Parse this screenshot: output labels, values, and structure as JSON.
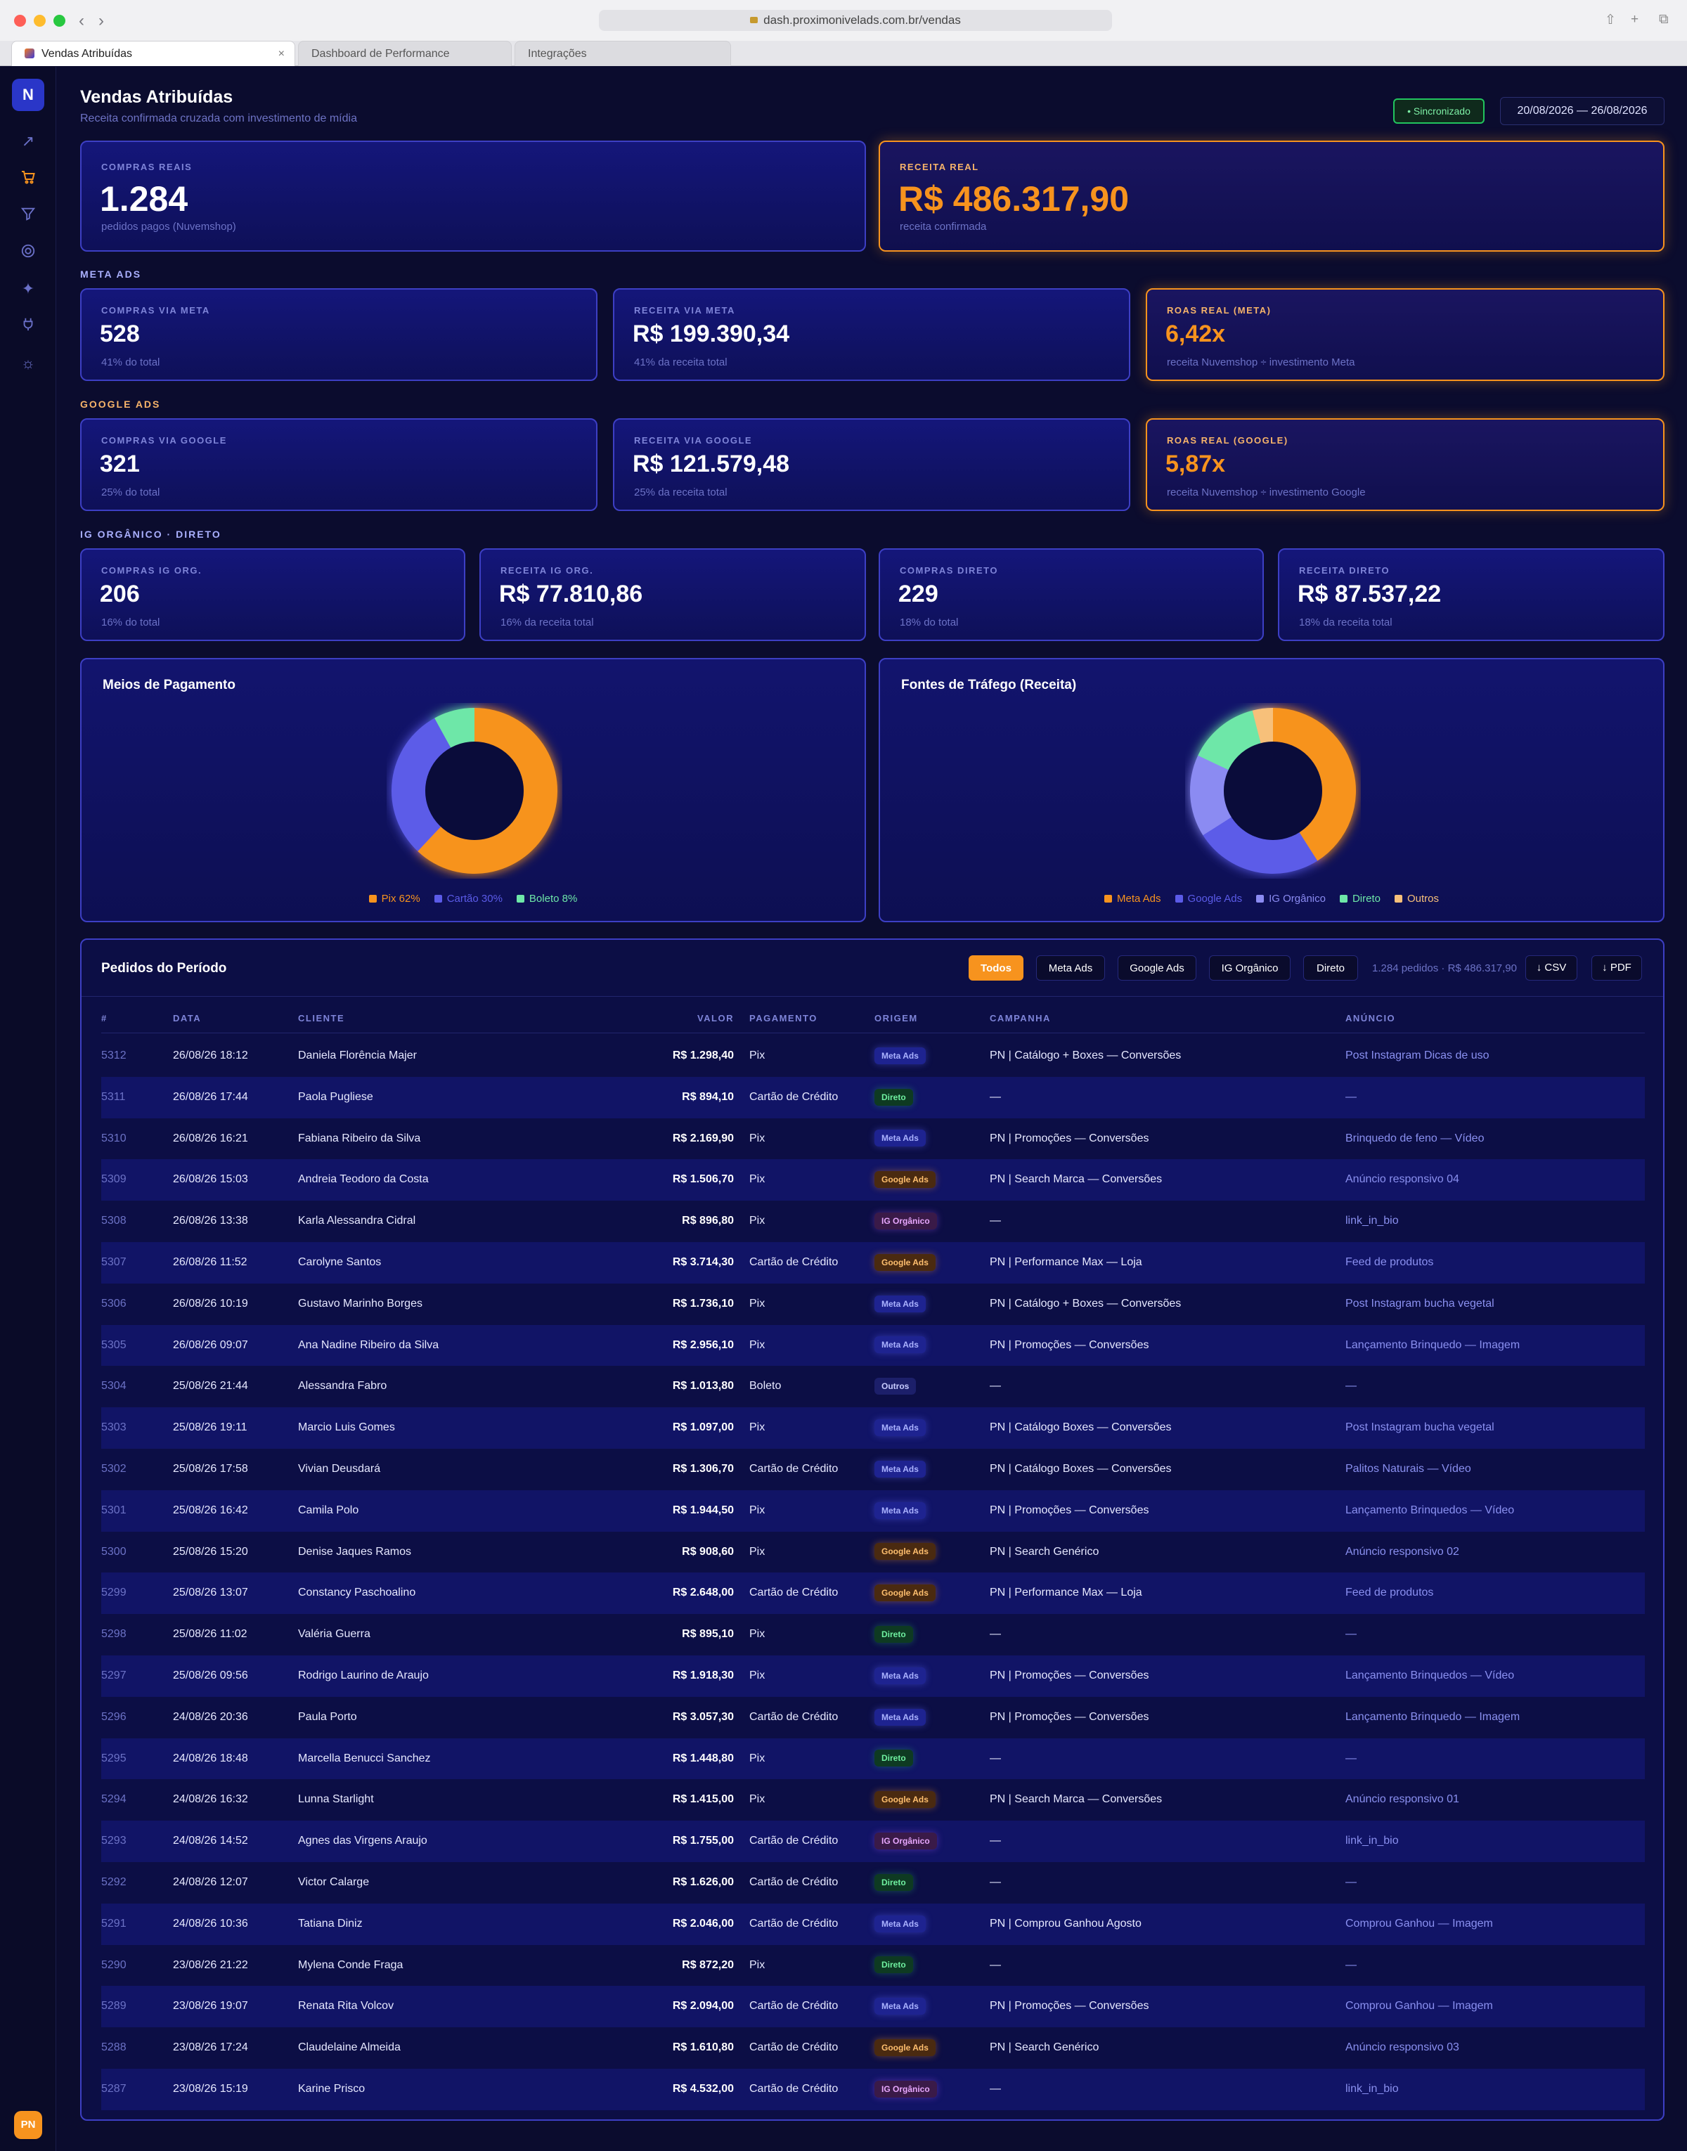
{
  "browser": {
    "url": "dash.proximonivelads.com.br/vendas",
    "tabs": [
      "Vendas Atribuídas",
      "Dashboard de Performance",
      "Integrações"
    ]
  },
  "sidebar": {
    "logo": "N",
    "avatar": "PN",
    "icons": [
      "trend-icon",
      "cart-icon",
      "filter-icon",
      "target-icon",
      "sparkle-icon",
      "plug-icon",
      "gear-icon"
    ]
  },
  "header": {
    "title": "Vendas Atribuídas",
    "subtitle": "Receita confirmada cruzada com investimento de mídia",
    "sync_label": "• Sincronizado",
    "date_range": "20/08/2026 — 26/08/2026"
  },
  "summary": {
    "purchases": {
      "label": "COMPRAS REAIS",
      "value": "1.284",
      "sub": "pedidos pagos (Nuvemshop)"
    },
    "revenue": {
      "label": "RECEITA REAL",
      "value": "R$ 486.317,90",
      "sub": "receita confirmada"
    }
  },
  "meta": {
    "section": "META ADS",
    "purchases": {
      "label": "COMPRAS VIA META",
      "value": "528",
      "sub": "41% do total"
    },
    "revenue": {
      "label": "RECEITA VIA META",
      "value": "R$ 199.390,34",
      "sub": "41% da receita total"
    },
    "roas": {
      "label": "ROAS REAL (META)",
      "value": "6,42x",
      "sub": "receita Nuvemshop ÷ investimento Meta"
    }
  },
  "google": {
    "section": "GOOGLE ADS",
    "purchases": {
      "label": "COMPRAS VIA GOOGLE",
      "value": "321",
      "sub": "25% do total"
    },
    "revenue": {
      "label": "RECEITA VIA GOOGLE",
      "value": "R$ 121.579,48",
      "sub": "25% da receita total"
    },
    "roas": {
      "label": "ROAS REAL (GOOGLE)",
      "value": "5,87x",
      "sub": "receita Nuvemshop ÷ investimento Google"
    }
  },
  "organic": {
    "section": "IG ORGÂNICO · DIRETO",
    "ig_purchases": {
      "label": "COMPRAS IG ORG.",
      "value": "206",
      "sub": "16% do total"
    },
    "ig_revenue": {
      "label": "RECEITA IG ORG.",
      "value": "R$ 77.810,86",
      "sub": "16% da receita total"
    },
    "direct_purchases": {
      "label": "COMPRAS DIRETO",
      "value": "229",
      "sub": "18% do total"
    },
    "direct_revenue": {
      "label": "RECEITA DIRETO",
      "value": "R$ 87.537,22",
      "sub": "18% da receita total"
    }
  },
  "chart_data": [
    {
      "type": "pie",
      "title": "Meios de Pagamento",
      "categories": [
        "Pix 62%",
        "Cartão 30%",
        "Boleto 8%"
      ],
      "values": [
        62,
        30,
        8
      ],
      "colors": [
        "#f7931e",
        "#5b5be8",
        "#6ee7a8"
      ],
      "legend": "bottom"
    },
    {
      "type": "pie",
      "title": "Fontes de Tráfego (Receita)",
      "categories": [
        "Meta Ads",
        "Google Ads",
        "IG Orgânico",
        "Direto",
        "Outros"
      ],
      "values": [
        41,
        25,
        16,
        14,
        4
      ],
      "colors": [
        "#f7931e",
        "#5b5be8",
        "#8b8bf2",
        "#6ee7a8",
        "#f7c07a"
      ],
      "legend": "bottom"
    }
  ],
  "orders": {
    "title": "Pedidos do Período",
    "filters": [
      "Todos",
      "Meta Ads",
      "Google Ads",
      "IG Orgânico",
      "Direto"
    ],
    "summary": "1.284 pedidos · R$ 486.317,90",
    "csv_label": "↓ CSV",
    "pdf_label": "↓ PDF",
    "columns": [
      "#",
      "DATA",
      "CLIENTE",
      "VALOR",
      "PAGAMENTO",
      "ORIGEM",
      "CAMPANHA",
      "ANÚNCIO"
    ],
    "rows": [
      {
        "id": "5312",
        "date": "26/08/26 18:12",
        "client": "Daniela Florência Majer",
        "value": "R$ 1.298,40",
        "payment": "Pix",
        "origin": "Meta Ads",
        "campaign": "PN | Catálogo + Boxes — Conversões",
        "ad": "Post Instagram Dicas de uso"
      },
      {
        "id": "5311",
        "date": "26/08/26 17:44",
        "client": "Paola Pugliese",
        "value": "R$ 894,10",
        "payment": "Cartão de Crédito",
        "origin": "Direto",
        "campaign": "—",
        "ad": "—"
      },
      {
        "id": "5310",
        "date": "26/08/26 16:21",
        "client": "Fabiana Ribeiro da Silva",
        "value": "R$ 2.169,90",
        "payment": "Pix",
        "origin": "Meta Ads",
        "campaign": "PN | Promoções — Conversões",
        "ad": "Brinquedo de feno — Vídeo"
      },
      {
        "id": "5309",
        "date": "26/08/26 15:03",
        "client": "Andreia Teodoro da Costa",
        "value": "R$ 1.506,70",
        "payment": "Pix",
        "origin": "Google Ads",
        "campaign": "PN | Search Marca — Conversões",
        "ad": "Anúncio responsivo 04"
      },
      {
        "id": "5308",
        "date": "26/08/26 13:38",
        "client": "Karla Alessandra Cidral",
        "value": "R$ 896,80",
        "payment": "Pix",
        "origin": "IG Orgânico",
        "campaign": "—",
        "ad": "link_in_bio"
      },
      {
        "id": "5307",
        "date": "26/08/26 11:52",
        "client": "Carolyne Santos",
        "value": "R$ 3.714,30",
        "payment": "Cartão de Crédito",
        "origin": "Google Ads",
        "campaign": "PN | Performance Max — Loja",
        "ad": "Feed de produtos"
      },
      {
        "id": "5306",
        "date": "26/08/26 10:19",
        "client": "Gustavo Marinho Borges",
        "value": "R$ 1.736,10",
        "payment": "Pix",
        "origin": "Meta Ads",
        "campaign": "PN | Catálogo + Boxes — Conversões",
        "ad": "Post Instagram bucha vegetal"
      },
      {
        "id": "5305",
        "date": "26/08/26 09:07",
        "client": "Ana Nadine Ribeiro da Silva",
        "value": "R$ 2.956,10",
        "payment": "Pix",
        "origin": "Meta Ads",
        "campaign": "PN | Promoções — Conversões",
        "ad": "Lançamento Brinquedo — Imagem"
      },
      {
        "id": "5304",
        "date": "25/08/26 21:44",
        "client": "Alessandra Fabro",
        "value": "R$ 1.013,80",
        "payment": "Boleto",
        "origin": "Outros",
        "campaign": "—",
        "ad": "—"
      },
      {
        "id": "5303",
        "date": "25/08/26 19:11",
        "client": "Marcio Luis Gomes",
        "value": "R$ 1.097,00",
        "payment": "Pix",
        "origin": "Meta Ads",
        "campaign": "PN | Catálogo Boxes — Conversões",
        "ad": "Post Instagram bucha vegetal"
      },
      {
        "id": "5302",
        "date": "25/08/26 17:58",
        "client": "Vivian Deusdará",
        "value": "R$ 1.306,70",
        "payment": "Cartão de Crédito",
        "origin": "Meta Ads",
        "campaign": "PN | Catálogo Boxes — Conversões",
        "ad": "Palitos Naturais — Vídeo"
      },
      {
        "id": "5301",
        "date": "25/08/26 16:42",
        "client": "Camila Polo",
        "value": "R$ 1.944,50",
        "payment": "Pix",
        "origin": "Meta Ads",
        "campaign": "PN | Promoções — Conversões",
        "ad": "Lançamento Brinquedos — Vídeo"
      },
      {
        "id": "5300",
        "date": "25/08/26 15:20",
        "client": "Denise Jaques Ramos",
        "value": "R$ 908,60",
        "payment": "Pix",
        "origin": "Google Ads",
        "campaign": "PN | Search Genérico",
        "ad": "Anúncio responsivo 02"
      },
      {
        "id": "5299",
        "date": "25/08/26 13:07",
        "client": "Constancy Paschoalino",
        "value": "R$ 2.648,00",
        "payment": "Cartão de Crédito",
        "origin": "Google Ads",
        "campaign": "PN | Performance Max — Loja",
        "ad": "Feed de produtos"
      },
      {
        "id": "5298",
        "date": "25/08/26 11:02",
        "client": "Valéria Guerra",
        "value": "R$ 895,10",
        "payment": "Pix",
        "origin": "Direto",
        "campaign": "—",
        "ad": "—"
      },
      {
        "id": "5297",
        "date": "25/08/26 09:56",
        "client": "Rodrigo Laurino de Araujo",
        "value": "R$ 1.918,30",
        "payment": "Pix",
        "origin": "Meta Ads",
        "campaign": "PN | Promoções — Conversões",
        "ad": "Lançamento Brinquedos — Vídeo"
      },
      {
        "id": "5296",
        "date": "24/08/26 20:36",
        "client": "Paula Porto",
        "value": "R$ 3.057,30",
        "payment": "Cartão de Crédito",
        "origin": "Meta Ads",
        "campaign": "PN | Promoções — Conversões",
        "ad": "Lançamento Brinquedo — Imagem"
      },
      {
        "id": "5295",
        "date": "24/08/26 18:48",
        "client": "Marcella Benucci Sanchez",
        "value": "R$ 1.448,80",
        "payment": "Pix",
        "origin": "Direto",
        "campaign": "—",
        "ad": "—"
      },
      {
        "id": "5294",
        "date": "24/08/26 16:32",
        "client": "Lunna Starlight",
        "value": "R$ 1.415,00",
        "payment": "Pix",
        "origin": "Google Ads",
        "campaign": "PN | Search Marca — Conversões",
        "ad": "Anúncio responsivo 01"
      },
      {
        "id": "5293",
        "date": "24/08/26 14:52",
        "client": "Agnes das Virgens Araujo",
        "value": "R$ 1.755,00",
        "payment": "Cartão de Crédito",
        "origin": "IG Orgânico",
        "campaign": "—",
        "ad": "link_in_bio"
      },
      {
        "id": "5292",
        "date": "24/08/26 12:07",
        "client": "Victor Calarge",
        "value": "R$ 1.626,00",
        "payment": "Cartão de Crédito",
        "origin": "Direto",
        "campaign": "—",
        "ad": "—"
      },
      {
        "id": "5291",
        "date": "24/08/26 10:36",
        "client": "Tatiana Diniz",
        "value": "R$ 2.046,00",
        "payment": "Cartão de Crédito",
        "origin": "Meta Ads",
        "campaign": "PN | Comprou Ganhou Agosto",
        "ad": "Comprou Ganhou — Imagem"
      },
      {
        "id": "5290",
        "date": "23/08/26 21:22",
        "client": "Mylena Conde Fraga",
        "value": "R$ 872,20",
        "payment": "Pix",
        "origin": "Direto",
        "campaign": "—",
        "ad": "—"
      },
      {
        "id": "5289",
        "date": "23/08/26 19:07",
        "client": "Renata Rita Volcov",
        "value": "R$ 2.094,00",
        "payment": "Cartão de Crédito",
        "origin": "Meta Ads",
        "campaign": "PN | Promoções — Conversões",
        "ad": "Comprou Ganhou — Imagem"
      },
      {
        "id": "5288",
        "date": "23/08/26 17:24",
        "client": "Claudelaine Almeida",
        "value": "R$ 1.610,80",
        "payment": "Cartão de Crédito",
        "origin": "Google Ads",
        "campaign": "PN | Search Genérico",
        "ad": "Anúncio responsivo 03"
      },
      {
        "id": "5287",
        "date": "23/08/26 15:19",
        "client": "Karine Prisco",
        "value": "R$ 4.532,00",
        "payment": "Cartão de Crédito",
        "origin": "IG Orgânico",
        "campaign": "—",
        "ad": "link_in_bio"
      }
    ]
  }
}
